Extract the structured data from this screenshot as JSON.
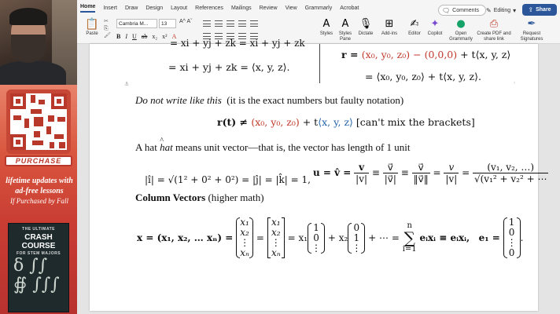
{
  "ribbon": {
    "menu_tabs": [
      "Home",
      "Insert",
      "Draw",
      "Design",
      "Layout",
      "References",
      "Mailings",
      "Review",
      "View",
      "Grammarly",
      "Acrobat"
    ],
    "comments_label": "Comments",
    "editing_label": "Editing",
    "share_label": "Share",
    "paste_label": "Paste",
    "font_name": "Cambria M...",
    "font_size": "13",
    "grow_shrink": "A^ Aˇ",
    "buttons": {
      "styles": "Styles",
      "styles_pane": "Styles Pane",
      "dictate": "Dictate",
      "addins": "Add-ins",
      "editor": "Editor",
      "copilot": "Copilot",
      "open_grammarly": "Open Grammarly",
      "create_pdf": "Create PDF and share link",
      "request_signatures": "Request Signatures"
    }
  },
  "promo": {
    "purchase": "PURCHASE",
    "line1": "lifetime updates with",
    "line2": "ad-free lessons",
    "line3": "If Purchased by Fall",
    "book_pre": "THE ULTIMATE",
    "book_title": "CRASH COURSE",
    "book_subtitle": "FOR STEM MAJORS"
  },
  "doc": {
    "top_left_1": "= xi + yj + zk = xi + yj + zk",
    "top_left_2": "= xi + yj + zk = ⟨x, y, z⟩.",
    "top_right_1_r": "r = ",
    "top_right_1_red": "(x₀, y₀, z₀) − (0,0,0)",
    "top_right_1_rest": " + t⟨x, y, z⟩",
    "top_right_2": "= ⟨x₀, y₀, z₀⟩ + t⟨x, y, z⟩.",
    "dont_write": "Do not write like this",
    "dont_write_note": "(it is the exact numbers but faulty notation)",
    "wrong_lhs": "r(t) ≠ ",
    "wrong_red": "(x₀, y₀, z₀)",
    "wrong_plus": " + t",
    "wrong_blue": "⟨x, y, z⟩",
    "wrong_note": "[can't mix the brackets]",
    "hat_line_pre": "A hat ",
    "hat_word": "hat",
    "hat_line_post": " means unit vector—that is, the vector has length of 1 unit",
    "unit_norms": "|î| = √(1² + 0² + 0²) = |ĵ| = |k̂| = 1,",
    "unit_u": "u = v̂ =",
    "column_heading": "Column Vectors",
    "column_heading_note": "(higher math)",
    "col_x_lhs": "x = (x₁, x₂, … xₙ) =",
    "col_entries": [
      "x₁",
      "x₂",
      "⋮",
      "xₙ"
    ],
    "col_e1_entries": [
      "1",
      "0",
      "⋮",
      "0"
    ],
    "col_e2_entries": [
      "0",
      "1",
      "⋮"
    ],
    "col_sum_mid": "= x₁",
    "col_sum_plus": "+ x₂",
    "col_sum_dots": "+ ⋯ =",
    "col_sum_top": "n",
    "col_sum_bottom": "i=1",
    "col_sum_rest": "eᵢxᵢ ≡ eᵢxᵢ,",
    "col_e1_lhs": "e₁ ="
  }
}
